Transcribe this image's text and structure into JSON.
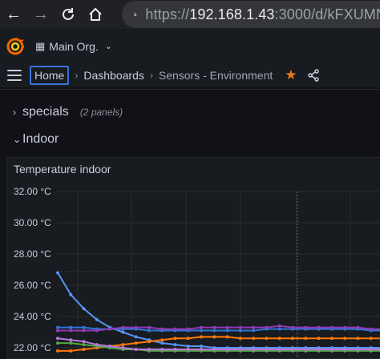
{
  "browser": {
    "url_scheme": "https://",
    "url_host": "192.168.1.43",
    "url_rest": ":3000/d/kFXUMN"
  },
  "topnav": {
    "org_label": "Main Org."
  },
  "breadcrumb": {
    "home": "Home",
    "dashboards": "Dashboards",
    "current": "Sensors - Environment"
  },
  "rows": [
    {
      "title": "specials",
      "count": "(2 panels)"
    },
    {
      "title": "Indoor"
    }
  ],
  "panel": {
    "title": "Temperature indoor"
  },
  "colors": {
    "accent": "#3d71d9",
    "star": "#eb7b18"
  },
  "chart_data": {
    "type": "line",
    "title": "Temperature indoor",
    "y_ticks": [
      "32.00 °C",
      "30.00 °C",
      "28.00 °C",
      "26.00 °C",
      "24.00 °C",
      "22.00 °C"
    ],
    "ylim": [
      22,
      32
    ],
    "unit": "°C",
    "grid": true,
    "x": [
      0,
      1,
      2,
      3,
      4,
      5,
      6,
      7,
      8,
      9,
      10,
      11,
      12,
      13,
      14,
      15,
      16,
      17,
      18,
      19,
      20,
      21,
      22,
      23,
      24,
      25
    ],
    "series": [
      {
        "color": "#5794f2",
        "values": [
          26.8,
          25.4,
          24.5,
          23.8,
          23.3,
          23.0,
          22.7,
          22.5,
          22.3,
          22.2,
          22.1,
          22.1,
          22.0,
          22.0,
          22.0,
          22.0,
          22.0,
          22.0,
          22.0,
          22.0,
          22.0,
          22.0,
          22.0,
          22.0,
          22.0,
          22.0
        ]
      },
      {
        "color": "#3274d9",
        "values": [
          23.3,
          23.3,
          23.3,
          23.2,
          23.2,
          23.2,
          23.2,
          23.1,
          23.1,
          23.1,
          23.1,
          23.1,
          23.1,
          23.1,
          23.1,
          23.1,
          23.2,
          23.2,
          23.2,
          23.2,
          23.2,
          23.2,
          23.2,
          23.2,
          23.1,
          23.1
        ]
      },
      {
        "color": "#8f3bb8",
        "values": [
          23.1,
          23.1,
          23.1,
          23.1,
          23.2,
          23.3,
          23.3,
          23.3,
          23.2,
          23.2,
          23.2,
          23.3,
          23.3,
          23.3,
          23.3,
          23.3,
          23.3,
          23.4,
          23.3,
          23.3,
          23.3,
          23.3,
          23.3,
          23.3,
          23.2,
          23.2
        ]
      },
      {
        "color": "#ff780a",
        "values": [
          21.8,
          21.8,
          21.9,
          22.0,
          22.1,
          22.2,
          22.3,
          22.4,
          22.5,
          22.6,
          22.6,
          22.7,
          22.7,
          22.7,
          22.6,
          22.6,
          22.6,
          22.6,
          22.6,
          22.6,
          22.6,
          22.6,
          22.6,
          22.6,
          22.6,
          22.6
        ]
      },
      {
        "color": "#56a64b",
        "values": [
          22.3,
          22.3,
          22.2,
          22.1,
          22.0,
          21.9,
          21.9,
          21.8,
          21.8,
          21.8,
          21.8,
          21.8,
          21.8,
          21.8,
          21.8,
          21.8,
          21.8,
          21.8,
          21.8,
          21.8,
          21.8,
          21.8,
          21.8,
          21.8,
          21.8,
          21.8
        ]
      },
      {
        "color": "#b877d9",
        "values": [
          22.6,
          22.5,
          22.4,
          22.2,
          22.1,
          22.0,
          21.9,
          21.9,
          21.9,
          21.9,
          21.9,
          21.9,
          21.9,
          21.9,
          21.9,
          21.9,
          21.9,
          21.9,
          21.9,
          21.9,
          21.9,
          21.9,
          21.9,
          21.9,
          21.9,
          21.9
        ]
      }
    ]
  }
}
